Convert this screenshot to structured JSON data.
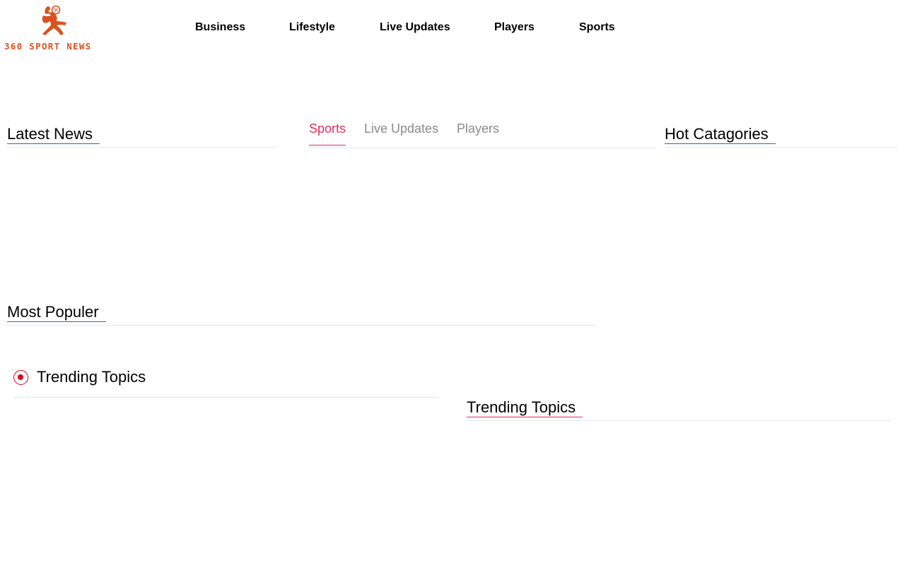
{
  "header": {
    "logo_text": "360 SPORT NEWS",
    "logo_color": "#d9531e",
    "nav": [
      {
        "label": "Business"
      },
      {
        "label": "Lifestyle"
      },
      {
        "label": "Live Updates"
      },
      {
        "label": "Players"
      },
      {
        "label": "Sports"
      }
    ]
  },
  "latest_news": {
    "title": "Latest News"
  },
  "tabs": [
    {
      "label": "Sports",
      "active": true
    },
    {
      "label": "Live Updates",
      "active": false
    },
    {
      "label": "Players",
      "active": false
    }
  ],
  "hot_categories": {
    "title": "Hot Catagories"
  },
  "most_popular": {
    "title": "Most Populer"
  },
  "trending_left": {
    "title": "Trending Topics",
    "icon": "radio-dot-icon"
  },
  "trending_right": {
    "title": "Trending Topics"
  },
  "colors": {
    "accent_blue": "#3a5cc9",
    "accent_red": "#e0315a",
    "radio_red": "#e0001b"
  }
}
